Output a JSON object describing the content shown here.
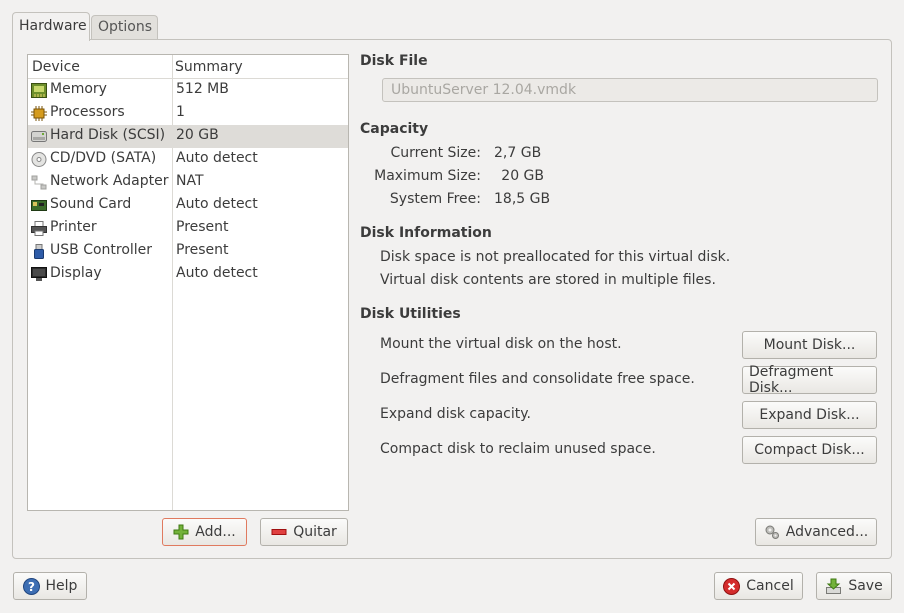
{
  "tabs": [
    {
      "label": "Hardware",
      "active": true
    },
    {
      "label": "Options",
      "active": false
    }
  ],
  "device_list": {
    "columns": [
      "Device",
      "Summary"
    ],
    "rows": [
      {
        "device": "Memory",
        "summary": "512 MB",
        "icon": "memory-icon"
      },
      {
        "device": "Processors",
        "summary": "1",
        "icon": "processor-icon"
      },
      {
        "device": "Hard Disk (SCSI)",
        "summary": "20 GB",
        "icon": "hard-disk-icon",
        "selected": true
      },
      {
        "device": "CD/DVD (SATA)",
        "summary": "Auto detect",
        "icon": "cd-dvd-icon"
      },
      {
        "device": "Network Adapter",
        "summary": "NAT",
        "icon": "network-adapter-icon"
      },
      {
        "device": "Sound Card",
        "summary": "Auto detect",
        "icon": "sound-card-icon"
      },
      {
        "device": "Printer",
        "summary": "Present",
        "icon": "printer-icon"
      },
      {
        "device": "USB Controller",
        "summary": "Present",
        "icon": "usb-icon"
      },
      {
        "device": "Display",
        "summary": "Auto detect",
        "icon": "display-icon"
      }
    ],
    "add_label": "Add...",
    "remove_label": "Quitar"
  },
  "disk_file": {
    "title": "Disk File",
    "value": "UbuntuServer 12.04.vmdk"
  },
  "capacity": {
    "title": "Capacity",
    "current_label": "Current Size:",
    "current_value": "2,7 GB",
    "max_label": "Maximum Size:",
    "max_value": "20 GB",
    "free_label": "System Free:",
    "free_value": "18,5 GB"
  },
  "disk_info": {
    "title": "Disk Information",
    "line1": "Disk space is not preallocated for this virtual disk.",
    "line2": "Virtual disk contents are stored in multiple files."
  },
  "utilities": {
    "title": "Disk Utilities",
    "items": [
      {
        "text": "Mount the virtual disk on the host.",
        "button": "Mount Disk..."
      },
      {
        "text": "Defragment files and consolidate free space.",
        "button": "Defragment Disk..."
      },
      {
        "text": "Expand disk capacity.",
        "button": "Expand Disk..."
      },
      {
        "text": "Compact disk to reclaim unused space.",
        "button": "Compact Disk..."
      }
    ],
    "advanced_label": "Advanced..."
  },
  "footer": {
    "help_label": "Help",
    "cancel_label": "Cancel",
    "save_label": "Save"
  },
  "colors": {
    "background": "#f2f1f0",
    "selection": "#dedcd8",
    "focus_border": "#e07a5f",
    "add_green": "#4e9a06",
    "remove_red": "#cc0000",
    "help_blue": "#3465a4"
  }
}
